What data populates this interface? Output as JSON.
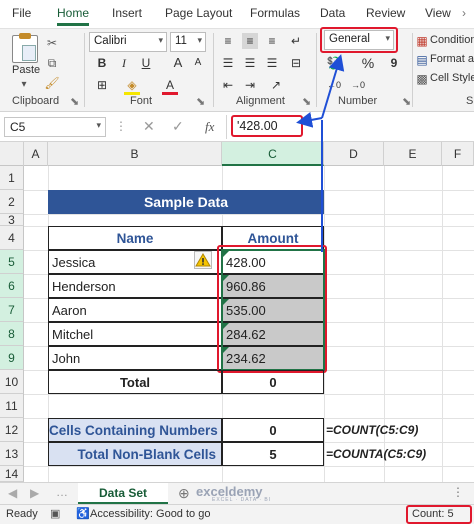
{
  "ribbon_tabs": [
    "File",
    "Home",
    "Insert",
    "Page Layout",
    "Formulas",
    "Data",
    "Review",
    "View"
  ],
  "clipboard": {
    "paste": "Paste",
    "group": "Clipboard"
  },
  "font": {
    "name": "Calibri",
    "size": "11",
    "group": "Font"
  },
  "alignment": {
    "group": "Alignment"
  },
  "number": {
    "format": "General",
    "group": "Number",
    "percent": "%",
    "comma": "9"
  },
  "styles": {
    "conditional": "Condition",
    "format_as": "Format as",
    "cell_styles": "Cell Styles",
    "group_cut": "S"
  },
  "formula_bar": {
    "name_box": "C5",
    "fx": "fx",
    "value": "'428.00"
  },
  "columns": [
    "A",
    "B",
    "C",
    "D",
    "E",
    "F"
  ],
  "rows": [
    "1",
    "2",
    "3",
    "4",
    "5",
    "6",
    "7",
    "8",
    "9",
    "10",
    "11",
    "12",
    "13",
    "14"
  ],
  "table": {
    "title": "Sample Data",
    "header_name": "Name",
    "header_amount": "Amount",
    "rows": [
      {
        "name": "Jessica",
        "amount": "428.00"
      },
      {
        "name": "Henderson",
        "amount": "960.86"
      },
      {
        "name": "Aaron",
        "amount": "535.00"
      },
      {
        "name": "Mitchel",
        "amount": "284.62"
      },
      {
        "name": "John",
        "amount": "234.62"
      }
    ],
    "total_label": "Total",
    "total_value": "0"
  },
  "summary": {
    "row1_label": "Cells Containing Numbers",
    "row1_value": "0",
    "row1_formula": "=COUNT(C5:C9)",
    "row2_label": "Total Non-Blank Cells",
    "row2_value": "5",
    "row2_formula": "=COUNTA(C5:C9)"
  },
  "sheet_tab": "Data Set",
  "watermark": {
    "name": "exceldemy",
    "tagline": "EXCEL · DATA · BI"
  },
  "status": {
    "ready": "Ready",
    "accessibility": "Accessibility: Good to go",
    "count": "Count: 5"
  },
  "colors": {
    "accent": "#217346",
    "header_blue": "#2f5597",
    "highlight_red": "#e0182d",
    "arrow_blue": "#1f4fd6",
    "summary_fill": "#d9e1f2"
  }
}
